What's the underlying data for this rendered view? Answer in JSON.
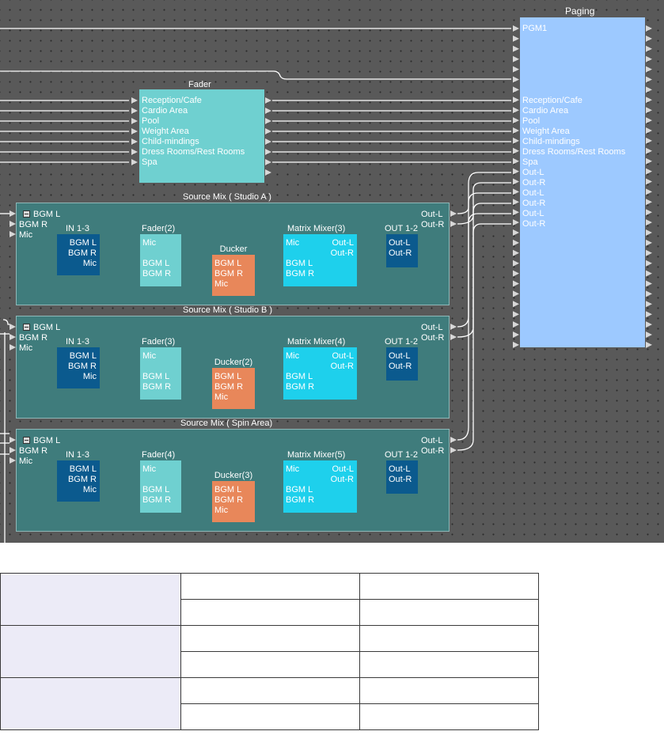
{
  "paging": {
    "title": "Paging",
    "inputs": [
      "PGM1",
      "Reception/Cafe",
      "Cardio Area",
      "Pool",
      "Weight Area",
      "Child-mindings",
      "Dress Rooms/Rest Rooms",
      "Spa",
      "Out-L",
      "Out-R",
      "Out-L",
      "Out-R",
      "Out-L",
      "Out-R"
    ]
  },
  "fader": {
    "title": "Fader",
    "inputs": [
      "Reception/Cafe",
      "Cardio Area",
      "Pool",
      "Weight Area",
      "Child-mindings",
      "Dress Rooms/Rest Rooms",
      "Spa"
    ]
  },
  "source_mixes": [
    {
      "title": "Source Mix ( Studio A )",
      "ins": [
        "BGM L",
        "BGM R",
        "Mic"
      ],
      "outs": [
        "Out-L",
        "Out-R"
      ],
      "in13": {
        "title": "IN 1-3",
        "ports": [
          "BGM L",
          "BGM R",
          "Mic"
        ]
      },
      "fader": {
        "title": "Fader(2)",
        "ports": [
          "Mic",
          "BGM L",
          "BGM R"
        ]
      },
      "ducker": {
        "title": "Ducker",
        "ports": [
          "BGM L",
          "BGM R",
          "Mic"
        ]
      },
      "matrix": {
        "title": "Matrix Mixer(3)",
        "in_ports": [
          "Mic",
          "BGM L",
          "BGM R"
        ],
        "out_ports": [
          "Out-L",
          "Out-R"
        ]
      },
      "out12": {
        "title": "OUT 1-2",
        "ports": [
          "Out-L",
          "Out-R"
        ]
      }
    },
    {
      "title": "Source Mix ( Studio B )",
      "ins": [
        "BGM L",
        "BGM R",
        "Mic"
      ],
      "outs": [
        "Out-L",
        "Out-R"
      ],
      "in13": {
        "title": "IN 1-3",
        "ports": [
          "BGM L",
          "BGM R",
          "Mic"
        ]
      },
      "fader": {
        "title": "Fader(3)",
        "ports": [
          "Mic",
          "BGM L",
          "BGM R"
        ]
      },
      "ducker": {
        "title": "Ducker(2)",
        "ports": [
          "BGM L",
          "BGM R",
          "Mic"
        ]
      },
      "matrix": {
        "title": "Matrix Mixer(4)",
        "in_ports": [
          "Mic",
          "BGM L",
          "BGM R"
        ],
        "out_ports": [
          "Out-L",
          "Out-R"
        ]
      },
      "out12": {
        "title": "OUT 1-2",
        "ports": [
          "Out-L",
          "Out-R"
        ]
      }
    },
    {
      "title": "Source Mix ( Spin Area)",
      "ins": [
        "BGM L",
        "BGM R",
        "Mic"
      ],
      "outs": [
        "Out-L",
        "Out-R"
      ],
      "in13": {
        "title": "IN 1-3",
        "ports": [
          "BGM L",
          "BGM R",
          "Mic"
        ]
      },
      "fader": {
        "title": "Fader(4)",
        "ports": [
          "Mic",
          "BGM L",
          "BGM R"
        ]
      },
      "ducker": {
        "title": "Ducker(3)",
        "ports": [
          "BGM L",
          "BGM R",
          "Mic"
        ]
      },
      "matrix": {
        "title": "Matrix Mixer(5)",
        "in_ports": [
          "Mic",
          "BGM L",
          "BGM R"
        ],
        "out_ports": [
          "Out-L",
          "Out-R"
        ]
      },
      "out12": {
        "title": "OUT 1-2",
        "ports": [
          "Out-L",
          "Out-R"
        ]
      }
    }
  ],
  "colors": {
    "canvas": "#595959",
    "group": "#3f7c7c",
    "in13": "#0b5a8e",
    "fader": "#6fd0d0",
    "ducker": "#e8875a",
    "matrix": "#1ed0ec",
    "paging": "#9dc9ff",
    "wire": "#ffffff"
  }
}
